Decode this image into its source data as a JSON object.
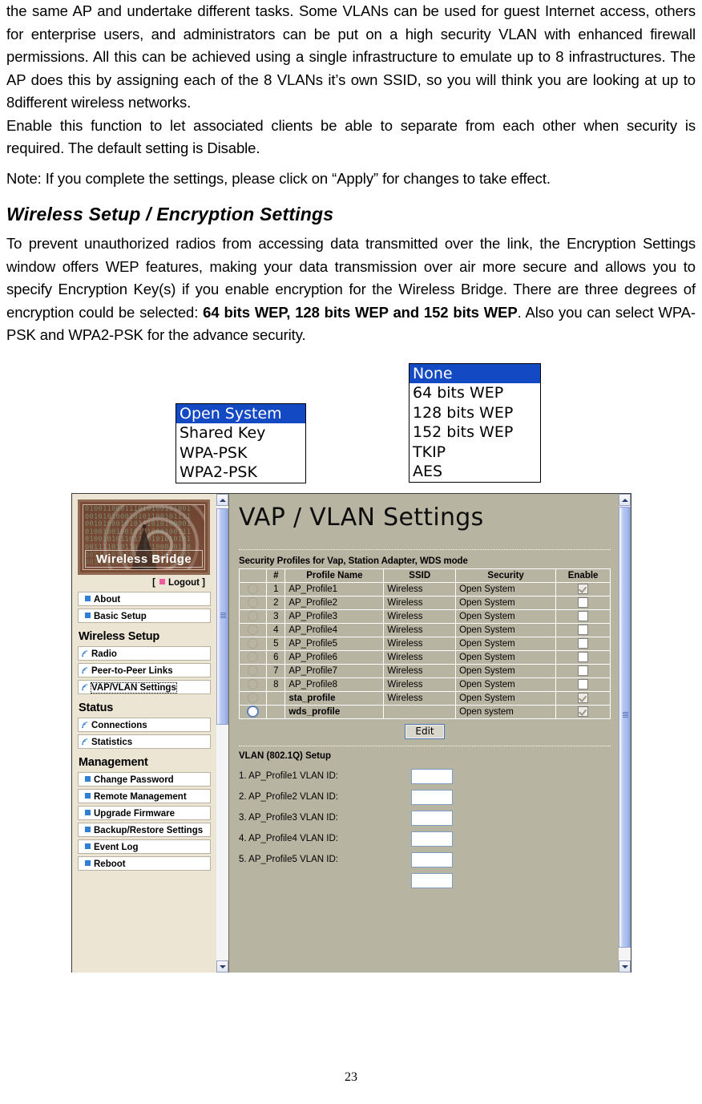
{
  "document": {
    "paragraphs": [
      "the same AP and undertake different tasks. Some VLANs can be used for guest Internet access, others for enterprise users, and administrators can be put on a high security VLAN with enhanced firewall permissions. All this can be achieved using a single infrastructure to emulate up to 8 infrastructures. The AP does this by assigning each of the 8 VLANs it’s own SSID, so you will think you are looking at up to 8different wireless networks.",
      "Enable this function to let associated clients be able to separate from each other when security is required. The default setting is Disable.",
      "Note: If you complete the settings, please click on “Apply” for changes to take effect."
    ],
    "section_heading": "Wireless Setup / Encryption Settings",
    "intro_parts": {
      "p1": "To prevent unauthorized radios from accessing data transmitted over the link, the Encryption Settings window offers WEP features, making your data transmission over air more secure and allows you to specify Encryption Key(s) if you enable encryption for the Wireless Bridge. There are three degrees of encryption could be selected: ",
      "bold1": "64 bits WEP, 128 bits WEP and 152 bits WEP",
      "p2": ". Also you can select WPA-PSK and WPA2-PSK for the advance security.",
      "full_text": "To prevent unauthorized radios from accessing data transmitted over the link, the Encryption Settings window offers WEP features, making your data transmission over air more secure and allows you to specify Encryption Key(s) if you enable encryption for the Wireless Bridge. There are three degrees of encryption could be selected: 64 bits WEP, 128 bits WEP and 152 bits WEP. Also you can select WPA-PSK and WPA2-PSK for the advance security."
    },
    "page_number": "23"
  },
  "figures": {
    "auth_dropdown": {
      "name": "authentication-type-list",
      "selected": "Open System",
      "options": [
        "Open System",
        "Shared Key",
        "WPA-PSK",
        "WPA2-PSK"
      ],
      "highlight_color": "#1449c4"
    },
    "encryption_dropdown": {
      "name": "encryption-type-list",
      "selected": "None",
      "options": [
        "None",
        "64 bits WEP",
        "128 bits WEP",
        "152 bits WEP",
        "TKIP",
        "AES"
      ],
      "highlight_color": "#1449c4"
    }
  },
  "screenshot": {
    "sidebar": {
      "logo": {
        "caption": "Wireless  Bridge",
        "binary_rows": [
          "010011000111010100101001",
          "001010100010101100101111",
          "001010001010111010100001",
          "010010010010101000100111",
          "010010101101110101010101",
          "001111010110103100010110",
          "001101010101010011101001",
          "001100101111010101011001"
        ]
      },
      "logout": {
        "open_bracket": "[",
        "label": "Logout",
        "close_bracket": "]"
      },
      "top_items": [
        {
          "label": "About",
          "icon": "square-bullet-icon"
        },
        {
          "label": "Basic Setup",
          "icon": "square-bullet-icon"
        }
      ],
      "groups": [
        {
          "title": "Wireless Setup",
          "items": [
            {
              "label": "Radio",
              "icon": "wifi-icon",
              "selected": false
            },
            {
              "label": "Peer-to-Peer Links",
              "icon": "wifi-icon",
              "selected": false
            },
            {
              "label": "VAP/VLAN Settings",
              "icon": "wifi-icon",
              "selected": true
            }
          ]
        },
        {
          "title": "Status",
          "items": [
            {
              "label": "Connections",
              "icon": "wifi-icon",
              "selected": false
            },
            {
              "label": "Statistics",
              "icon": "wifi-icon",
              "selected": false
            }
          ]
        },
        {
          "title": "Management",
          "items": [
            {
              "label": "Change Password",
              "icon": "square-bullet-icon",
              "selected": false
            },
            {
              "label": "Remote Management",
              "icon": "square-bullet-icon",
              "selected": false
            },
            {
              "label": "Upgrade Firmware",
              "icon": "square-bullet-icon",
              "selected": false
            },
            {
              "label": "Backup/Restore Settings",
              "icon": "square-bullet-icon",
              "selected": false
            },
            {
              "label": "Event Log",
              "icon": "square-bullet-icon",
              "selected": false
            },
            {
              "label": "Reboot",
              "icon": "square-bullet-icon",
              "selected": false
            }
          ]
        }
      ]
    },
    "main": {
      "title": "VAP / VLAN Settings",
      "table_caption": "Security Profiles for Vap, Station Adapter, WDS mode",
      "columns": [
        "",
        "#",
        "Profile Name",
        "SSID",
        "Security",
        "Enable"
      ],
      "rows": [
        {
          "selected": false,
          "num": "1",
          "name": "AP_Profile1",
          "ssid": "Wireless",
          "security": "Open System",
          "enabled": true,
          "bold": false
        },
        {
          "selected": false,
          "num": "2",
          "name": "AP_Profile2",
          "ssid": "Wireless",
          "security": "Open System",
          "enabled": false,
          "bold": false
        },
        {
          "selected": false,
          "num": "3",
          "name": "AP_Profile3",
          "ssid": "Wireless",
          "security": "Open System",
          "enabled": false,
          "bold": false
        },
        {
          "selected": false,
          "num": "4",
          "name": "AP_Profile4",
          "ssid": "Wireless",
          "security": "Open System",
          "enabled": false,
          "bold": false
        },
        {
          "selected": false,
          "num": "5",
          "name": "AP_Profile5",
          "ssid": "Wireless",
          "security": "Open System",
          "enabled": false,
          "bold": false
        },
        {
          "selected": false,
          "num": "6",
          "name": "AP_Profile6",
          "ssid": "Wireless",
          "security": "Open System",
          "enabled": false,
          "bold": false
        },
        {
          "selected": false,
          "num": "7",
          "name": "AP_Profile7",
          "ssid": "Wireless",
          "security": "Open System",
          "enabled": false,
          "bold": false
        },
        {
          "selected": false,
          "num": "8",
          "name": "AP_Profile8",
          "ssid": "Wireless",
          "security": "Open System",
          "enabled": false,
          "bold": false
        },
        {
          "selected": false,
          "num": "",
          "name": "sta_profile",
          "ssid": "Wireless",
          "security": "Open System",
          "enabled": true,
          "bold": true
        },
        {
          "selected": true,
          "num": "",
          "name": "wds_profile",
          "ssid": "",
          "security": "Open system",
          "enabled": true,
          "bold": true
        }
      ],
      "edit_button": "Edit",
      "vlan_section_title": "VLAN (802.1Q) Setup",
      "vlan_rows": [
        {
          "label": "1. AP_Profile1 VLAN ID:",
          "value": ""
        },
        {
          "label": "2. AP_Profile2 VLAN ID:",
          "value": ""
        },
        {
          "label": "3. AP_Profile3 VLAN ID:",
          "value": ""
        },
        {
          "label": "4. AP_Profile4 VLAN ID:",
          "value": ""
        },
        {
          "label": "5. AP_Profile5 VLAN ID:",
          "value": ""
        }
      ]
    },
    "colors": {
      "main_background": "#b8b4a2",
      "sidebar_background": "#ece5d4",
      "logo_background": "#7b4d37",
      "logout_bullet": "#ef5ba1",
      "nav_bullet": "#2f7fd4",
      "scrollbar_thumb": "#a9bcf0"
    }
  }
}
